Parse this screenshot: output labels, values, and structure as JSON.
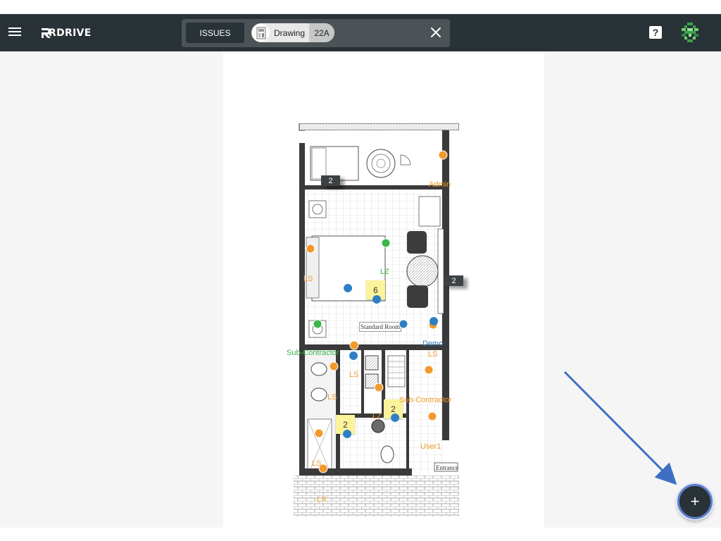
{
  "app": {
    "brand_name": "RDRIVE",
    "accent_color": "#283237"
  },
  "header": {
    "menu_icon": "hamburger-menu-icon",
    "help_icon": "help-icon",
    "help_glyph": "?",
    "user_avatar_icon": "pixel-avatar-icon"
  },
  "filter_bar": {
    "issues_label": "ISSUES",
    "chip_label": "Drawing",
    "chip_count": "22A",
    "chip_icon": "drawing-thumbnail-icon",
    "clear_icon": "close-icon"
  },
  "drawing": {
    "room_labels": {
      "standard_room": "Standard Room",
      "entrance": "Entrance"
    },
    "count_flags": [
      "2",
      "2"
    ],
    "sticky_notes": [
      "6",
      "2",
      "2"
    ],
    "pin_labels": [
      {
        "text": "Admin",
        "color": "orange"
      },
      {
        "text": "LS",
        "color": "orange"
      },
      {
        "text": "LZ",
        "color": "green"
      },
      {
        "text": "Sub-Contractor",
        "color": "green"
      },
      {
        "text": "Demo",
        "color": "blue"
      },
      {
        "text": "LS",
        "color": "orange"
      },
      {
        "text": "LS",
        "color": "orange"
      },
      {
        "text": "LS",
        "color": "orange"
      },
      {
        "text": "Sub-Contractor",
        "color": "orange"
      },
      {
        "text": "LZ",
        "color": "orange"
      },
      {
        "text": "User1",
        "color": "orange"
      },
      {
        "text": "LS",
        "color": "orange"
      },
      {
        "text": "LS",
        "color": "orange"
      }
    ],
    "status_colors": {
      "orange": "#f29a2c",
      "green": "#3bb54a",
      "blue": "#2f7fc6"
    }
  },
  "fab": {
    "glyph": "+",
    "icon": "add-icon"
  }
}
